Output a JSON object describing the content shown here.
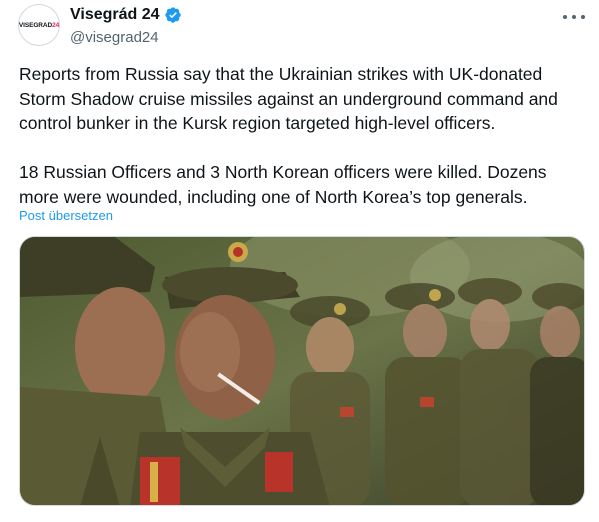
{
  "author": {
    "display_name": "Visegrád 24",
    "handle": "@visegrad24",
    "avatar_text_part1": "VISEGRAD",
    "avatar_text_part2": "24",
    "verified_icon": "verified-badge-icon"
  },
  "tweet": {
    "text": "Reports from Russia say that the Ukrainian strikes with UK-donated\nStorm Shadow cruise missiles against an underground command and\ncontrol bunker in the Kursk region targeted high-level officers.\n\n18 Russian Officers and 3 North Korean officers were killed. Dozens\nmore were wounded, including one of North Korea’s top generals.",
    "translate_label": "Post übersetzen"
  },
  "media": {
    "image_icon": "photo-of-soldiers"
  },
  "colors": {
    "accent": "#1d9bf0",
    "text": "#0f1419",
    "secondary": "#536471",
    "border": "#cfd9de"
  }
}
